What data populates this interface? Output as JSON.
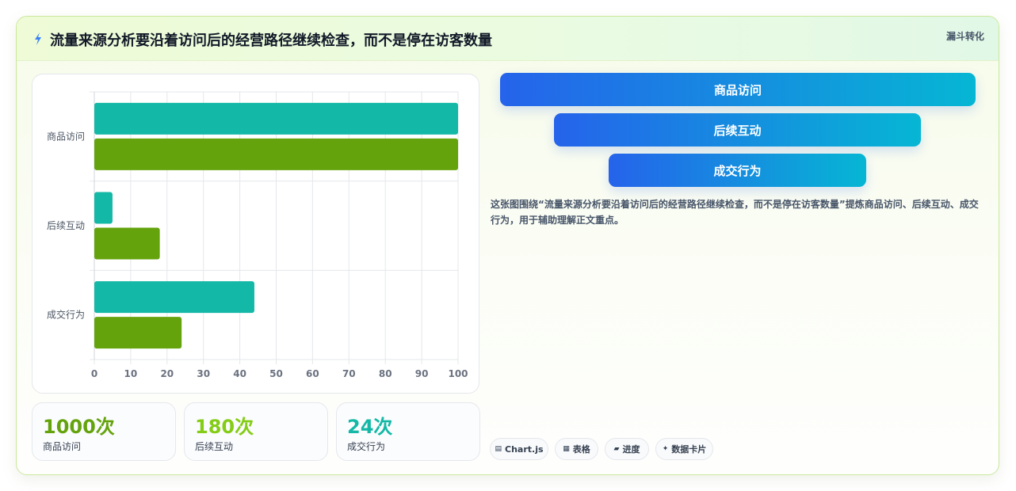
{
  "header": {
    "icon": "lightning-icon",
    "title": "流量来源分析要沿着访问后的经营路径继续检查，而不是停在访客数量",
    "tag": "漏斗转化"
  },
  "chart_data": {
    "type": "bar",
    "orientation": "horizontal",
    "categories": [
      "商品访问",
      "后续互动",
      "成交行为"
    ],
    "series": [
      {
        "values": [
          100,
          5,
          44
        ],
        "color": "#14b8a6"
      },
      {
        "values": [
          100,
          18,
          24
        ],
        "color": "#65a30d"
      }
    ],
    "xlim": [
      0,
      100
    ],
    "xticks": [
      0,
      10,
      20,
      30,
      40,
      50,
      60,
      70,
      80,
      90,
      100
    ],
    "grid": true
  },
  "stats": [
    {
      "value": "1000次",
      "label": "商品访问",
      "color": "#65a30d"
    },
    {
      "value": "180次",
      "label": "后续互动",
      "color": "#84cc16"
    },
    {
      "value": "24次",
      "label": "成交行为",
      "color": "#14b8a6"
    }
  ],
  "funnel": [
    "商品访问",
    "后续互动",
    "成交行为"
  ],
  "description": "这张图围绕“流量来源分析要沿着访问后的经营路径继续检查，而不是停在访客数量”提炼商品访问、后续互动、成交行为，用于辅助理解正文重点。",
  "pills": [
    {
      "icon": "▤",
      "icon_name": "chart-icon",
      "label": "Chart.js"
    },
    {
      "icon": "▦",
      "icon_name": "table-icon",
      "label": "表格"
    },
    {
      "icon": "▰",
      "icon_name": "progress-icon",
      "label": "进度"
    },
    {
      "icon": "✦",
      "icon_name": "sparkle-icon",
      "label": "数据卡片"
    }
  ]
}
